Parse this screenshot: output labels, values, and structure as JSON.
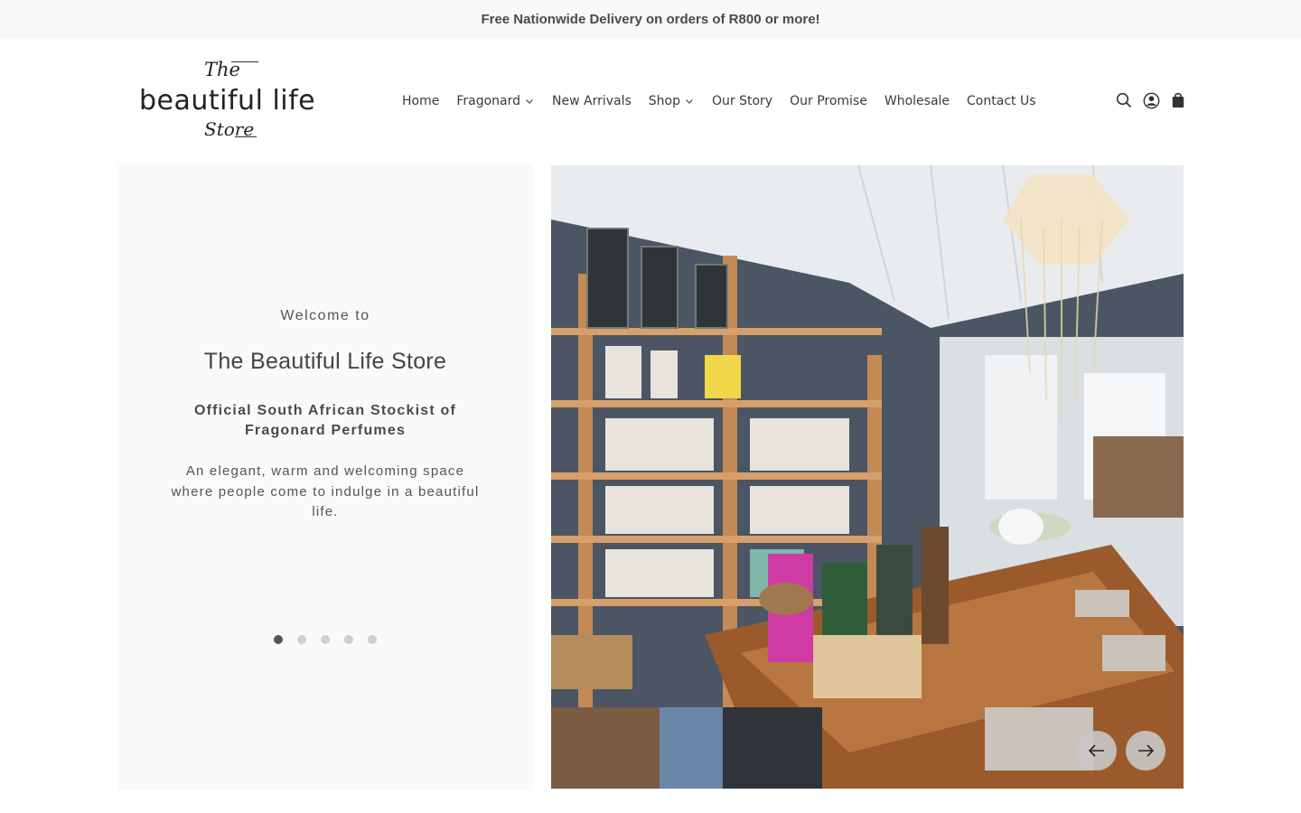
{
  "announcement": {
    "text": "Free Nationwide Delivery on orders of R800 or more!"
  },
  "logo": {
    "top": "The",
    "main": "beautiful life",
    "bottom": "Store"
  },
  "nav": {
    "items": [
      {
        "label": "Home",
        "has_dropdown": false
      },
      {
        "label": "Fragonard",
        "has_dropdown": true
      },
      {
        "label": "New Arrivals",
        "has_dropdown": false
      },
      {
        "label": "Shop",
        "has_dropdown": true
      },
      {
        "label": "Our Story",
        "has_dropdown": false
      },
      {
        "label": "Our Promise",
        "has_dropdown": false
      },
      {
        "label": "Wholesale",
        "has_dropdown": false
      },
      {
        "label": "Contact Us",
        "has_dropdown": false
      }
    ]
  },
  "header_icons": [
    "search-icon",
    "account-icon",
    "cart-icon"
  ],
  "hero": {
    "welcome": "Welcome to",
    "title": "The Beautiful Life Store",
    "stockist": "Official South African Stockist of Fragonard Perfumes",
    "description": "An elegant, warm and welcoming space where people come to indulge in a beautiful life.",
    "slide_count": 5,
    "active_slide": 1
  },
  "colors": {
    "announcement_bg": "#f9f9f9",
    "panel_bg": "#fafafa",
    "text_dark": "#444444",
    "dot_active": "#555555",
    "dot_inactive": "#cfcfcf"
  }
}
